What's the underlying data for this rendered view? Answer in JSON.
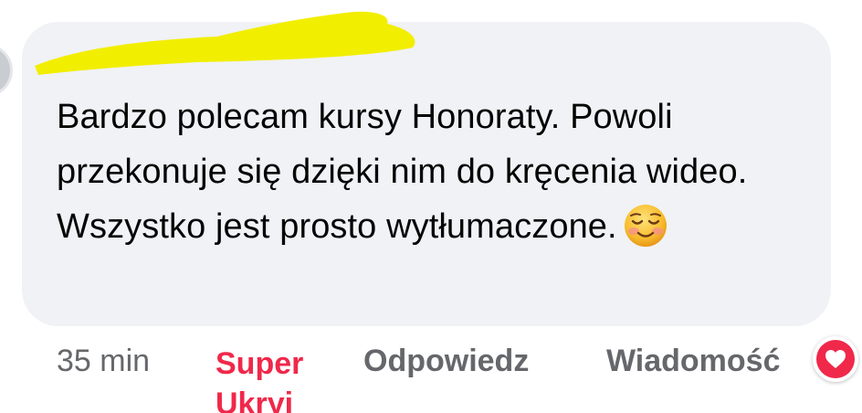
{
  "comment": {
    "text": "Bardzo polecam kursy Honoraty. Powoli przekonuje się dzięki nim do kręcenia wideo. Wszystko jest prosto wytłumaczone.",
    "emoji": "smiling-face-icon",
    "author_redacted": true
  },
  "actions": {
    "timestamp": "35 min",
    "reaction_label": "Super Ukryj",
    "reply_label": "Odpowiedz",
    "message_label": "Wiadomość"
  },
  "reaction_badge": {
    "icon": "love-reaction-icon"
  },
  "colors": {
    "bubble": "#f0f2f5",
    "text": "#050505",
    "secondary": "#65676b",
    "reaction": "#f0284a",
    "highlight": "#f2ee00"
  }
}
